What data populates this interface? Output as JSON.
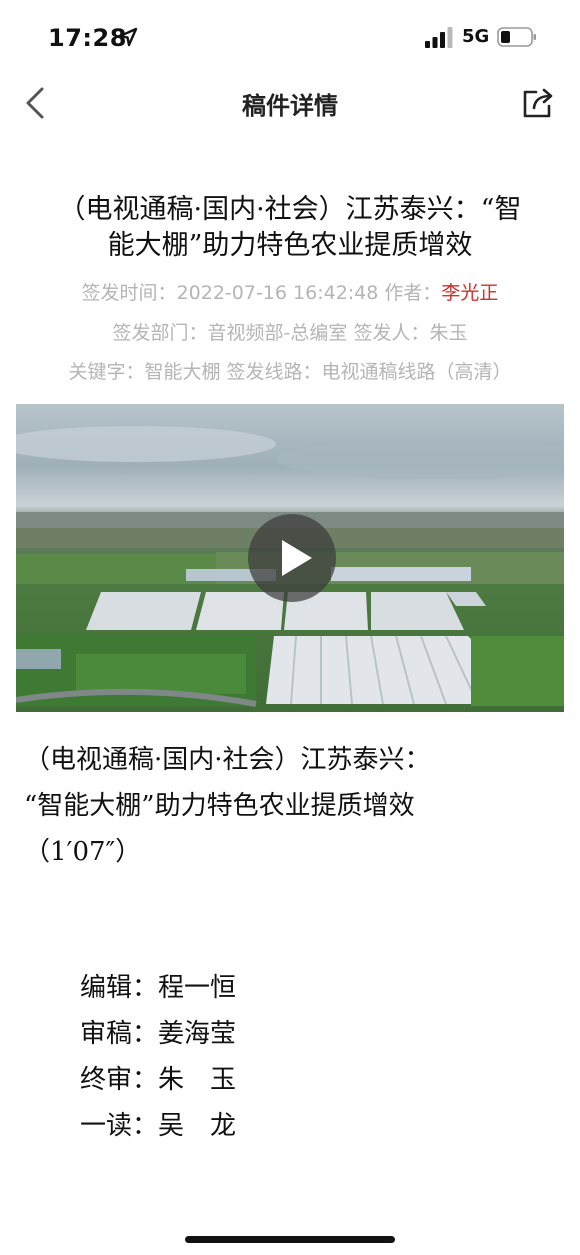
{
  "status_bar": {
    "time": "17:28",
    "network": "5G",
    "icons": [
      "location-arrow-icon",
      "signal-icon",
      "battery-icon"
    ]
  },
  "nav": {
    "title": "稿件详情",
    "back_icon": "chevron-left-icon",
    "share_icon": "share-icon"
  },
  "article": {
    "headline_line1": "（电视通稿·国内·社会）江苏泰兴：“智",
    "headline_line2": "能大棚”助力特色农业提质增效",
    "meta": {
      "issue_time_label": "签发时间：",
      "issue_time": "2022-07-16 16:42:48",
      "author_label": "作者：",
      "author": "李光正",
      "department_label": "签发部门：",
      "department": "音视频部-总编室",
      "issuer_label": "签发人：",
      "issuer": "朱玉",
      "keyword_label": "关键字：",
      "keyword": "智能大棚",
      "route_label": "签发线路：",
      "route": "电视通稿线路（高清）"
    },
    "video": {
      "play_icon": "play-icon"
    },
    "caption_line1": "（电视通稿·国内·社会）江苏泰兴：",
    "caption_line2": "“智能大棚”助力特色农业提质增效",
    "caption_line3": "（1′07″）",
    "credits": [
      "编辑：程一恒",
      "审稿：姜海莹",
      "终审：朱　玉",
      "一读：吴　龙"
    ]
  },
  "colors": {
    "author_accent": "#d0302a",
    "meta_gray": "#b5b5b5"
  }
}
